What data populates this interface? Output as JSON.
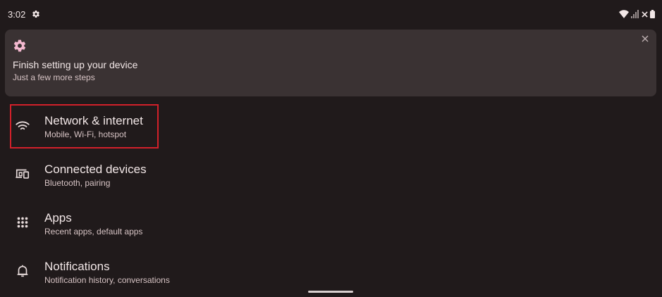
{
  "status_bar": {
    "time": "3:02",
    "icons": [
      "gear-icon",
      "wifi-icon",
      "signal-icon",
      "no-data-x-icon",
      "battery-icon"
    ]
  },
  "setup_card": {
    "title": "Finish setting up your device",
    "subtitle": "Just a few more steps",
    "icons": [
      "gear-icon",
      "close-icon"
    ]
  },
  "settings": {
    "items": [
      {
        "title": "Network & internet",
        "summary": "Mobile, Wi-Fi, hotspot",
        "icon": "wifi-icon",
        "highlighted": true
      },
      {
        "title": "Connected devices",
        "summary": "Bluetooth, pairing",
        "icon": "devices-icon"
      },
      {
        "title": "Apps",
        "summary": "Recent apps, default apps",
        "icon": "apps-grid-icon"
      },
      {
        "title": "Notifications",
        "summary": "Notification history, conversations",
        "icon": "bell-icon"
      }
    ]
  },
  "colors": {
    "background": "#201a1b",
    "card": "#3a3233",
    "accent_gear": "#f3b8cf",
    "highlight": "#d2202a"
  }
}
